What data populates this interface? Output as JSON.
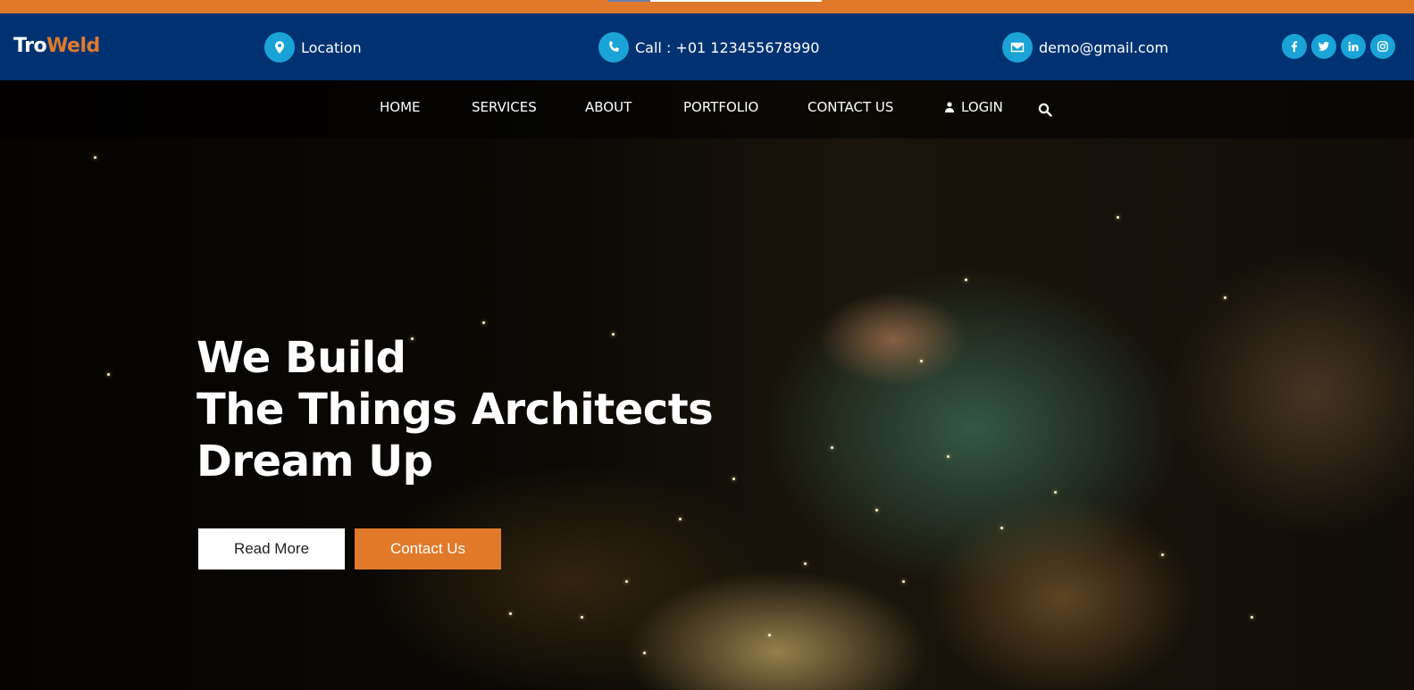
{
  "colors": {
    "accent_orange": "#e07a2a",
    "header_blue": "#003272",
    "icon_blue": "#1aa3d6"
  },
  "brand": {
    "part1": "Tro",
    "part2": "Weld"
  },
  "info": {
    "location": {
      "icon": "map-marker-icon",
      "text": "Location"
    },
    "phone": {
      "icon": "phone-icon",
      "text": "Call : +01 123455678990"
    },
    "email": {
      "icon": "envelope-icon",
      "text": "demo@gmail.com"
    }
  },
  "socials": [
    {
      "icon": "facebook-icon",
      "glyph": "f"
    },
    {
      "icon": "twitter-icon",
      "glyph": ""
    },
    {
      "icon": "linkedin-icon",
      "glyph": "in"
    },
    {
      "icon": "instagram-icon",
      "glyph": ""
    }
  ],
  "nav": {
    "home": "HOME",
    "services": "SERVICES",
    "about": "ABOUT",
    "portfolio": "PORTFOLIO",
    "contact": "CONTACT US",
    "login": "LOGIN",
    "search_icon": "search-icon"
  },
  "hero": {
    "line1": "We Build",
    "line2": "The Things Architects",
    "line3": "Dream Up",
    "read_more": "Read More",
    "contact_us": "Contact Us"
  }
}
